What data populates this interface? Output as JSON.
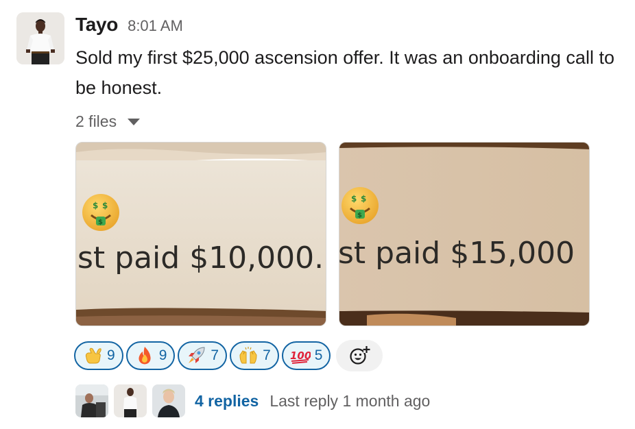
{
  "message": {
    "author": "Tayo",
    "timestamp": "8:01 AM",
    "text": "Sold my first $25,000 ascension offer. It was an onboarding call to be honest."
  },
  "files": {
    "label": "2 files",
    "items": [
      {
        "caption_text": "st paid $10,000.",
        "emoji": "money-mouth-face"
      },
      {
        "caption_text": "st paid $15,000",
        "emoji": "money-mouth-face"
      }
    ]
  },
  "reactions": [
    {
      "emoji": "call-me-hand",
      "count": "9"
    },
    {
      "emoji": "fire",
      "count": "9"
    },
    {
      "emoji": "rocket",
      "count": "7"
    },
    {
      "emoji": "raising-hands",
      "count": "7"
    },
    {
      "emoji": "hundred-points",
      "count": "5"
    }
  ],
  "add_reaction_icon": "add-reaction-icon",
  "thread": {
    "replies": "4 replies",
    "last_reply": "Last reply 1 month ago"
  },
  "colors": {
    "link": "#1264a3",
    "reaction_bg": "#e8f5fa",
    "muted_text": "#616061",
    "text": "#1d1c1d"
  }
}
